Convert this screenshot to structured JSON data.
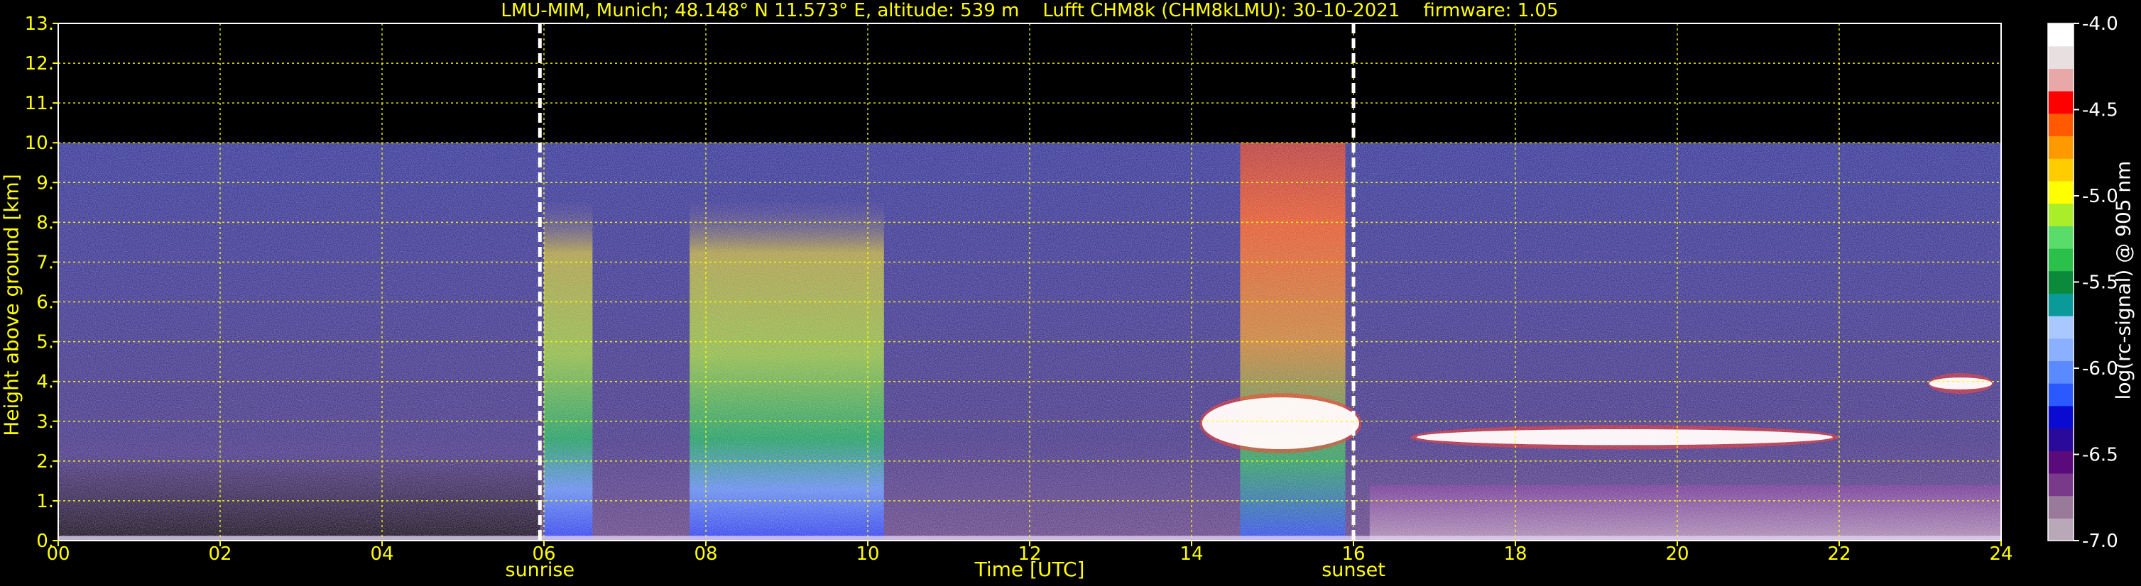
{
  "header": {
    "title": "LMU-MIM, Munich; 48.148° N 11.573° E, altitude: 539 m    Lufft CHM8k (CHM8kLMU): 30-10-2021    firmware: 1.05"
  },
  "chart_data": {
    "type": "heatmap",
    "title": "LMU-MIM, Munich; 48.148° N 11.573° E, altitude: 539 m    Lufft CHM8k (CHM8kLMU): 30-10-2021    firmware: 1.05",
    "xlabel": "Time [UTC]",
    "ylabel": "Height above ground [km]",
    "xlim": [
      0,
      24
    ],
    "ylim": [
      0,
      13
    ],
    "xticks": [
      0,
      2,
      4,
      6,
      8,
      10,
      12,
      14,
      16,
      18,
      20,
      22,
      24
    ],
    "xtick_labels": [
      "00",
      "02",
      "04",
      "06",
      "08",
      "10",
      "12",
      "14",
      "16",
      "18",
      "20",
      "22",
      "24"
    ],
    "yticks": [
      0,
      1,
      2,
      3,
      4,
      5,
      6,
      7,
      8,
      9,
      10,
      11,
      12,
      13
    ],
    "ytick_labels": [
      "0.",
      "1.",
      "2.",
      "3.",
      "4.",
      "5.",
      "6.",
      "7.",
      "8.",
      "9.",
      "10.",
      "11.",
      "12.",
      "13."
    ],
    "grid": true,
    "data_ceiling_km": 10,
    "colorbar": {
      "label": "log(rc-signal) @ 905 nm",
      "range": [
        -7.0,
        -4.0
      ],
      "ticks": [
        -4.0,
        -4.5,
        -5.0,
        -5.5,
        -6.0,
        -6.5,
        -7.0
      ],
      "tick_labels": [
        "-4.0",
        "-4.5",
        "-5.0",
        "-5.5",
        "-6.0",
        "-6.5",
        "-7.0"
      ],
      "colors": [
        "#b8a8b8",
        "#9a7a9a",
        "#7a3a8a",
        "#5a0a7a",
        "#2a0a9a",
        "#0a0ad0",
        "#2a5aff",
        "#5a8aff",
        "#8ab0ff",
        "#a8c8ff",
        "#0a9a9a",
        "#0a8a3a",
        "#2ac04a",
        "#5adc6a",
        "#aaee2a",
        "#ffff00",
        "#ffcc00",
        "#ff9900",
        "#ff5a00",
        "#ff0000",
        "#e8a8a8",
        "#e8e0e0",
        "#ffffff"
      ]
    },
    "events": [
      {
        "name": "sunrise",
        "time_utc": 5.95
      },
      {
        "name": "sunset",
        "time_utc": 16.0
      }
    ],
    "features": [
      {
        "kind": "aerosol layer",
        "start": 6.0,
        "end": 6.6,
        "top_km": 8.5,
        "color": "#a8d040"
      },
      {
        "kind": "aerosol layer",
        "start": 7.8,
        "end": 10.2,
        "top_km": 8.5,
        "color": "#9acc40"
      },
      {
        "kind": "aerosol layer",
        "start": 14.6,
        "end": 15.9,
        "top_km": 10,
        "color": "#e09030"
      },
      {
        "kind": "cloud layer",
        "start": 14.1,
        "end": 16.1,
        "base_km": 2.3,
        "top_km": 3.6,
        "color": "#ffffff"
      },
      {
        "kind": "cloud layer",
        "start": 16.7,
        "end": 22.0,
        "base_km": 2.4,
        "top_km": 2.8,
        "color": "#ffffff"
      },
      {
        "kind": "cloud layer",
        "start": 23.1,
        "end": 23.9,
        "base_km": 3.8,
        "top_km": 4.1,
        "color": "#ffffff"
      }
    ]
  }
}
